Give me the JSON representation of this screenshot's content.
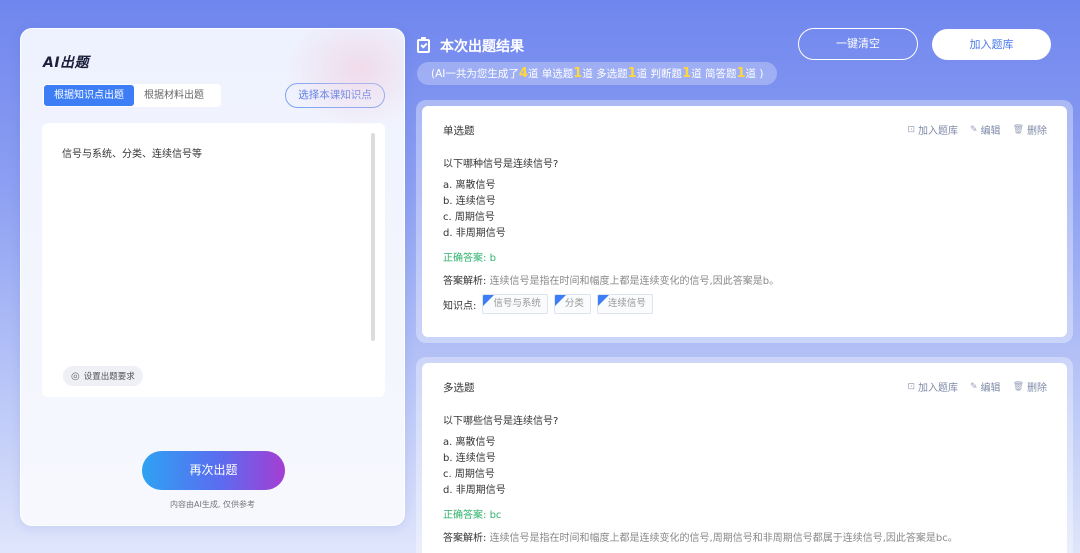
{
  "left": {
    "title": "AI出题",
    "tabs": [
      {
        "label": "根据知识点出题",
        "active": true
      },
      {
        "label": "根据材料出题",
        "active": false
      }
    ],
    "select_button": "选择本课知识点",
    "input_text": "信号与系统、分类、连续信号等",
    "requirement_chip": "设置出题要求",
    "regenerate_button": "再次出题",
    "disclaimer": "内容由AI生成, 仅供参考"
  },
  "header": {
    "title": "本次出题结果",
    "summary": {
      "prefix": "(AI一共为您生成了",
      "total": "4",
      "total_suffix": "道 单选题",
      "single": "1",
      "single_suffix": "道 多选题",
      "multi": "1",
      "multi_suffix": "道 判断题",
      "judge": "1",
      "judge_suffix": "道 简答题",
      "short": "1",
      "short_suffix": "道 )"
    },
    "clear_button": "一键清空",
    "add_bank_button": "加入题库"
  },
  "actions": {
    "add": "加入题库",
    "edit": "编辑",
    "delete": "删除"
  },
  "questions": [
    {
      "type": "单选题",
      "stem": "以下哪种信号是连续信号?",
      "options": [
        "a. 离散信号",
        "b. 连续信号",
        "c. 周期信号",
        "d. 非周期信号"
      ],
      "answer_label": "正确答案:",
      "answer": "b",
      "analysis_label": "答案解析:",
      "analysis": "连续信号是指在时间和幅度上都是连续变化的信号,因此答案是b。",
      "kp_label": "知识点:",
      "knowledge_points": [
        "信号与系统",
        "分类",
        "连续信号"
      ]
    },
    {
      "type": "多选题",
      "stem": "以下哪些信号是连续信号?",
      "options": [
        "a. 离散信号",
        "b. 连续信号",
        "c. 周期信号",
        "d. 非周期信号"
      ],
      "answer_label": "正确答案:",
      "answer": "bc",
      "analysis_label": "答案解析:",
      "analysis": "连续信号是指在时间和幅度上都是连续变化的信号,周期信号和非周期信号都属于连续信号,因此答案是bc。"
    }
  ]
}
